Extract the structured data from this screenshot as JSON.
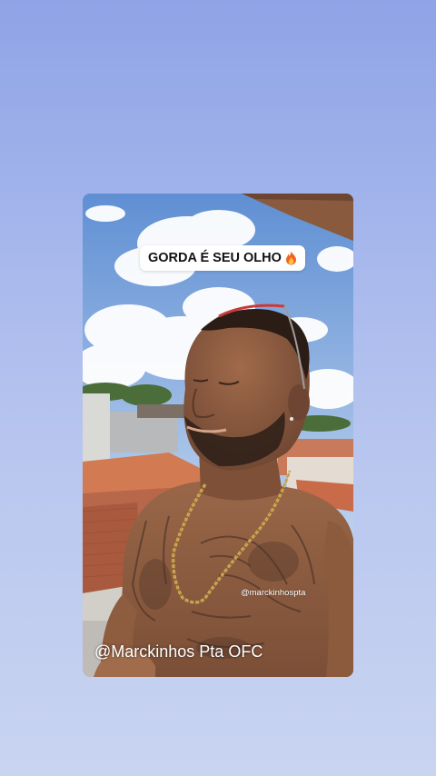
{
  "story": {
    "caption_text": "GORDA É SEU OLHO",
    "caption_icon": "fire-emoji-icon",
    "watermark_small": "@marckinhospta",
    "watermark_large": "@Marckinhos Pta OFC"
  },
  "colors": {
    "background_top": "#8fa3e6",
    "background_bottom": "#c9d4f1",
    "caption_background": "#ffffff",
    "caption_text": "#111111",
    "watermark_text": "#ffffff"
  }
}
